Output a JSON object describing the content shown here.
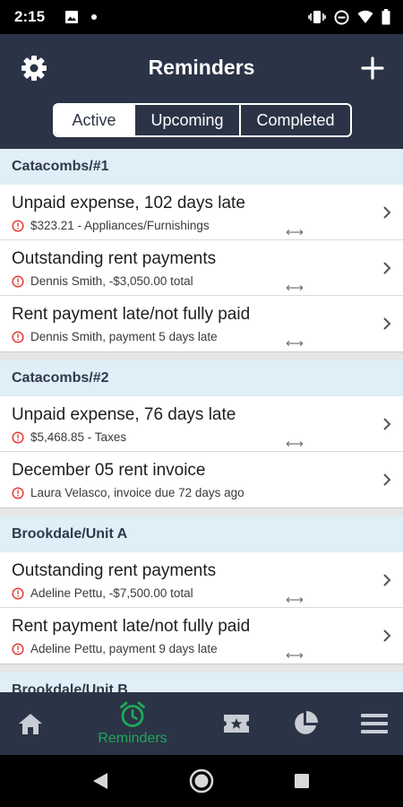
{
  "status_bar": {
    "time": "2:15"
  },
  "header": {
    "title": "Reminders"
  },
  "tabs": [
    {
      "label": "Active",
      "active": true
    },
    {
      "label": "Upcoming",
      "active": false
    },
    {
      "label": "Completed",
      "active": false
    }
  ],
  "groups": [
    {
      "name": "Catacombs/#1",
      "items": [
        {
          "title": "Unpaid expense, 102 days late",
          "subtitle": "$323.21 - Appliances/Furnishings"
        },
        {
          "title": "Outstanding rent payments",
          "subtitle": "Dennis Smith, -$3,050.00 total"
        },
        {
          "title": "Rent payment late/not fully paid",
          "subtitle": "Dennis Smith, payment 5 days late"
        }
      ]
    },
    {
      "name": "Catacombs/#2",
      "items": [
        {
          "title": "Unpaid expense, 76 days late",
          "subtitle": "$5,468.85 - Taxes"
        },
        {
          "title": "December 05 rent invoice",
          "subtitle": "Laura Velasco, invoice due 72 days ago"
        }
      ]
    },
    {
      "name": "Brookdale/Unit A",
      "items": [
        {
          "title": "Outstanding rent payments",
          "subtitle": "Adeline Pettu, -$7,500.00 total"
        },
        {
          "title": "Rent payment late/not fully paid",
          "subtitle": "Adeline Pettu, payment 9 days late"
        }
      ]
    },
    {
      "name": "Brookdale/Unit B",
      "items": []
    }
  ],
  "bottom_nav": {
    "items": [
      {
        "icon": "home-icon",
        "label": ""
      },
      {
        "icon": "alarm-clock-icon",
        "label": "Reminders",
        "active": true
      },
      {
        "icon": "ticket-star-icon",
        "label": ""
      },
      {
        "icon": "pie-chart-icon",
        "label": ""
      },
      {
        "icon": "menu-icon",
        "label": ""
      }
    ]
  },
  "colors": {
    "header_bg": "#2b3446",
    "section_bg": "#dfeef7",
    "accent_green": "#1fa85a",
    "alert_red": "#e53935"
  }
}
